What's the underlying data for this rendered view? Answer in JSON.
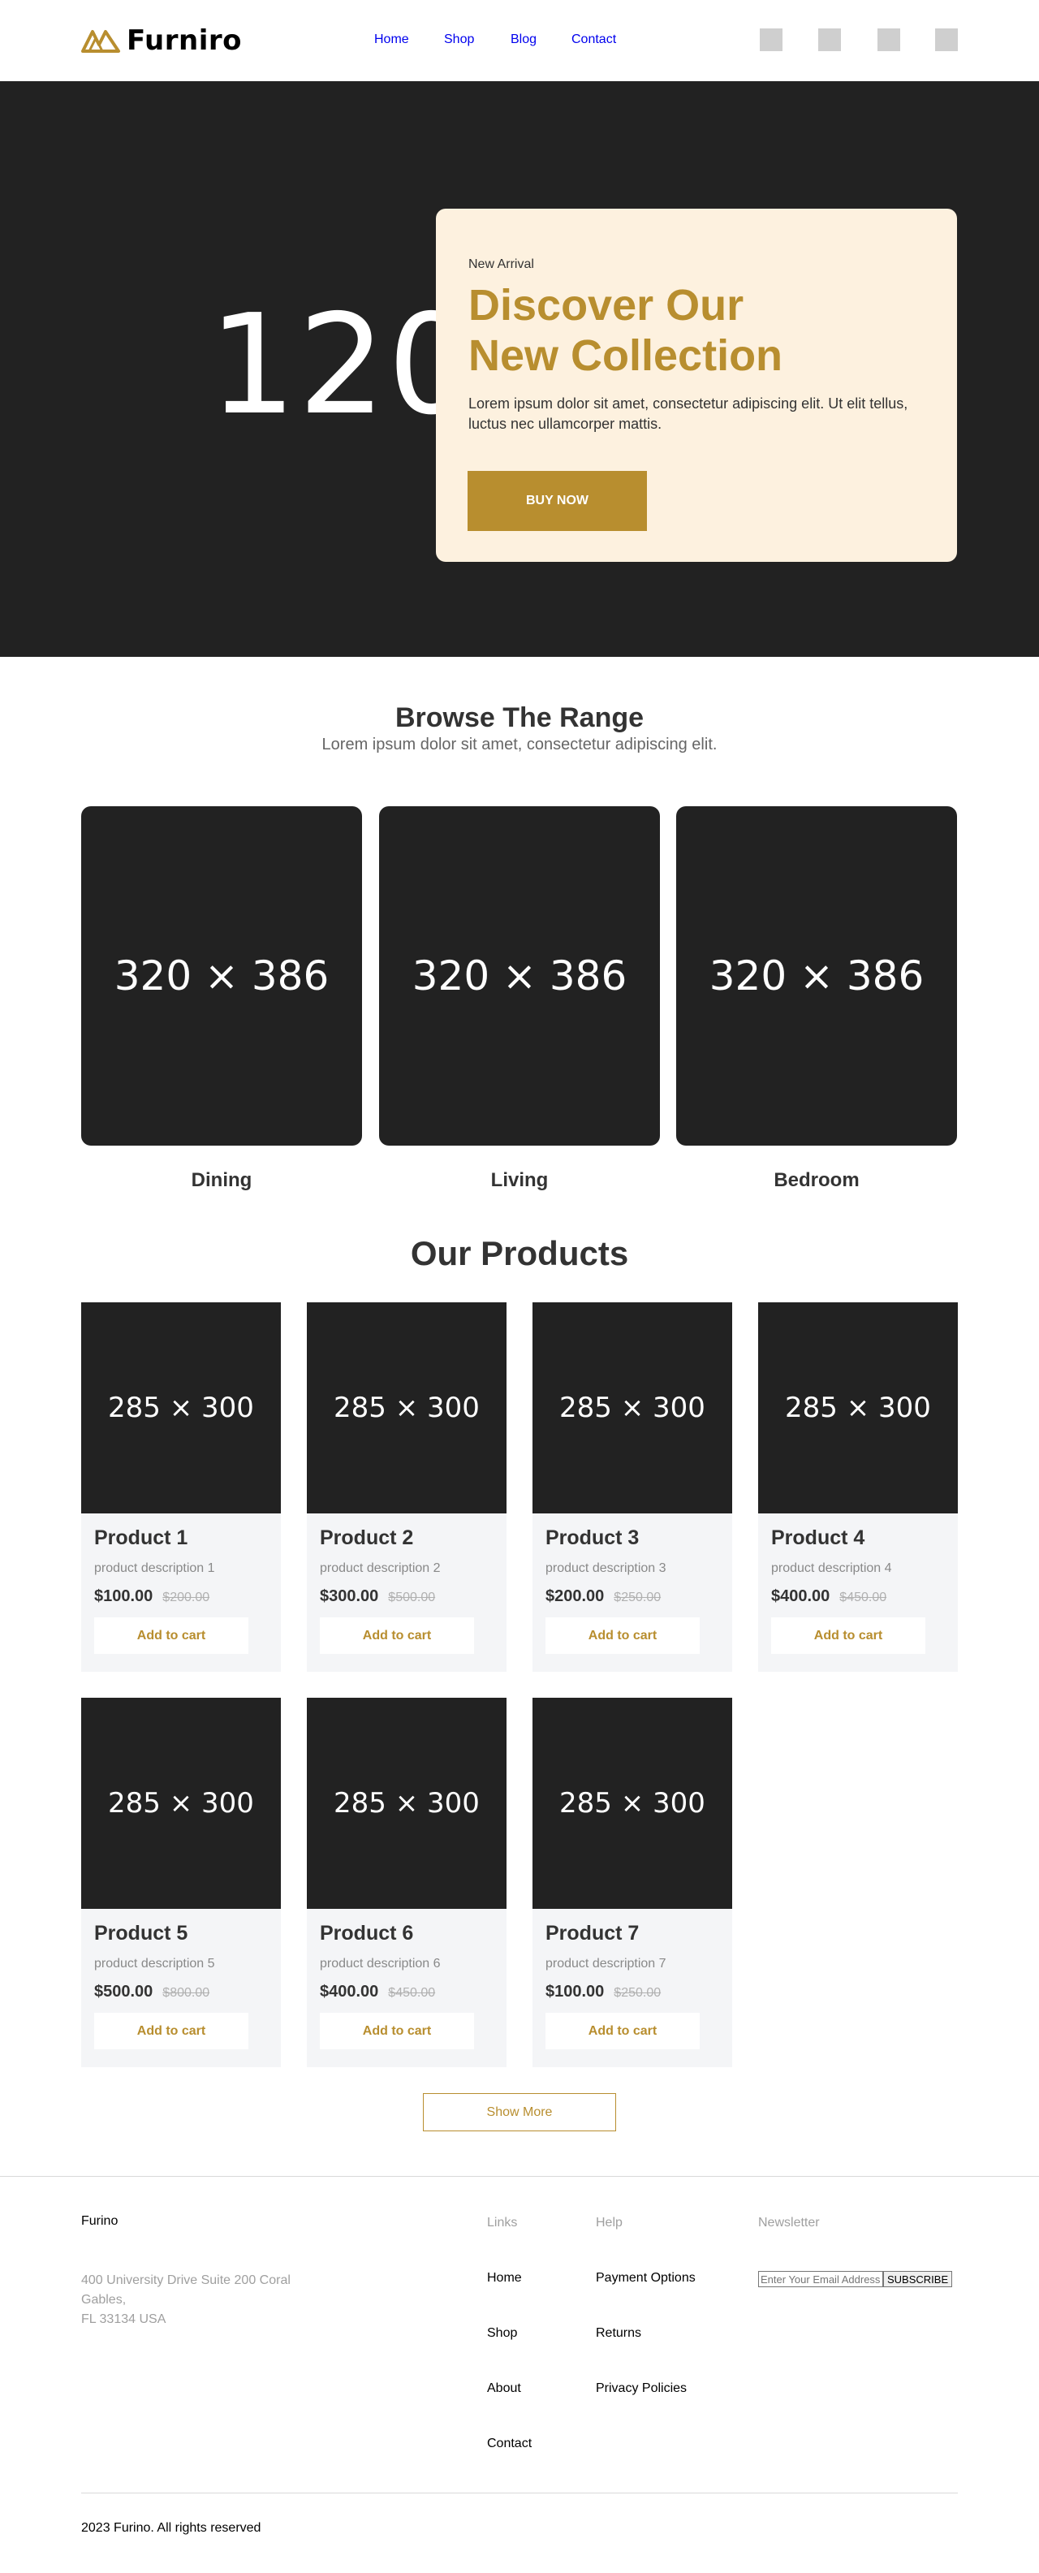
{
  "header": {
    "logo_text": "Furniro",
    "nav": [
      "Home",
      "Shop",
      "Blog",
      "Contact"
    ],
    "icons": [
      "account-icon",
      "search-icon",
      "heart-icon",
      "cart-icon"
    ]
  },
  "hero": {
    "bg_text": "1200",
    "subtitle": "New Arrival",
    "title_line1": "Discover Our",
    "title_line2": "New Collection",
    "description": "Lorem ipsum dolor sit amet, consectetur adipiscing elit. Ut elit tellus, luctus nec ullamcorper mattis.",
    "button": "BUY NOW"
  },
  "browse": {
    "title": "Browse The Range",
    "subtitle": "Lorem ipsum dolor sit amet, consectetur adipiscing elit.",
    "categories": [
      {
        "placeholder": "320 × 386",
        "label": "Dining"
      },
      {
        "placeholder": "320 × 386",
        "label": "Living"
      },
      {
        "placeholder": "320 × 386",
        "label": "Bedroom"
      }
    ]
  },
  "products": {
    "title": "Our Products",
    "items": [
      {
        "placeholder": "285 × 300",
        "name": "Product 1",
        "desc": "product description 1",
        "price": "$100.00",
        "old_price": "$200.00",
        "button": "Add to cart"
      },
      {
        "placeholder": "285 × 300",
        "name": "Product 2",
        "desc": "product description 2",
        "price": "$300.00",
        "old_price": "$500.00",
        "button": "Add to cart"
      },
      {
        "placeholder": "285 × 300",
        "name": "Product 3",
        "desc": "product description 3",
        "price": "$200.00",
        "old_price": "$250.00",
        "button": "Add to cart"
      },
      {
        "placeholder": "285 × 300",
        "name": "Product 4",
        "desc": "product description 4",
        "price": "$400.00",
        "old_price": "$450.00",
        "button": "Add to cart"
      },
      {
        "placeholder": "285 × 300",
        "name": "Product 5",
        "desc": "product description 5",
        "price": "$500.00",
        "old_price": "$800.00",
        "button": "Add to cart"
      },
      {
        "placeholder": "285 × 300",
        "name": "Product 6",
        "desc": "product description 6",
        "price": "$400.00",
        "old_price": "$450.00",
        "button": "Add to cart"
      },
      {
        "placeholder": "285 × 300",
        "name": "Product 7",
        "desc": "product description 7",
        "price": "$100.00",
        "old_price": "$250.00",
        "button": "Add to cart"
      }
    ],
    "show_more": "Show More"
  },
  "footer": {
    "brand": "Furino",
    "address_line1": "400 University Drive Suite 200 Coral Gables,",
    "address_line2": "FL 33134 USA",
    "links_heading": "Links",
    "links": [
      "Home",
      "Shop",
      "About",
      "Contact"
    ],
    "help_heading": "Help",
    "help": [
      "Payment Options",
      "Returns",
      "Privacy Policies"
    ],
    "newsletter_heading": "Newsletter",
    "newsletter_placeholder": "Enter Your Email Address",
    "subscribe": "SUBSCRIBE",
    "copyright": "2023 Furino. All rights reserved"
  },
  "colors": {
    "accent": "#b88e2f",
    "hero_bg": "#222222",
    "card_bg": "#fdf1df",
    "product_bg": "#f4f5f7"
  }
}
